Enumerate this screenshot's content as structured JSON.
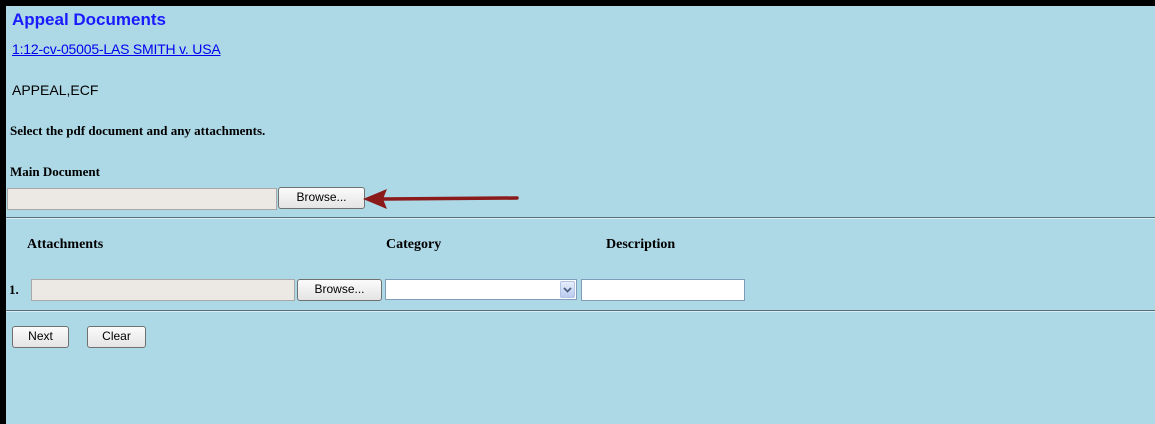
{
  "header": {
    "title": "Appeal Documents",
    "case_link": "1:12-cv-05005-LAS SMITH v. USA",
    "case_flags": "APPEAL,ECF"
  },
  "form": {
    "instructions": "Select the pdf document and any attachments.",
    "main_document": {
      "label": "Main Document",
      "file_value": "",
      "browse_label": "Browse..."
    },
    "attachments": {
      "columns": [
        "Attachments",
        "Category",
        "Description"
      ],
      "rows": [
        {
          "number": "1.",
          "file_value": "",
          "browse_label": "Browse...",
          "category_selected": "",
          "description_value": ""
        }
      ]
    }
  },
  "actions": {
    "next_label": "Next",
    "clear_label": "Clear"
  },
  "colors": {
    "background": "#add8e6",
    "title": "#1a1aff",
    "link": "#0000ee",
    "annotation_arrow": "#8b1a1a",
    "frame_border": "#000000"
  },
  "icons": {
    "annotation": "arrow-left-icon",
    "dropdown": "chevron-down-icon"
  }
}
